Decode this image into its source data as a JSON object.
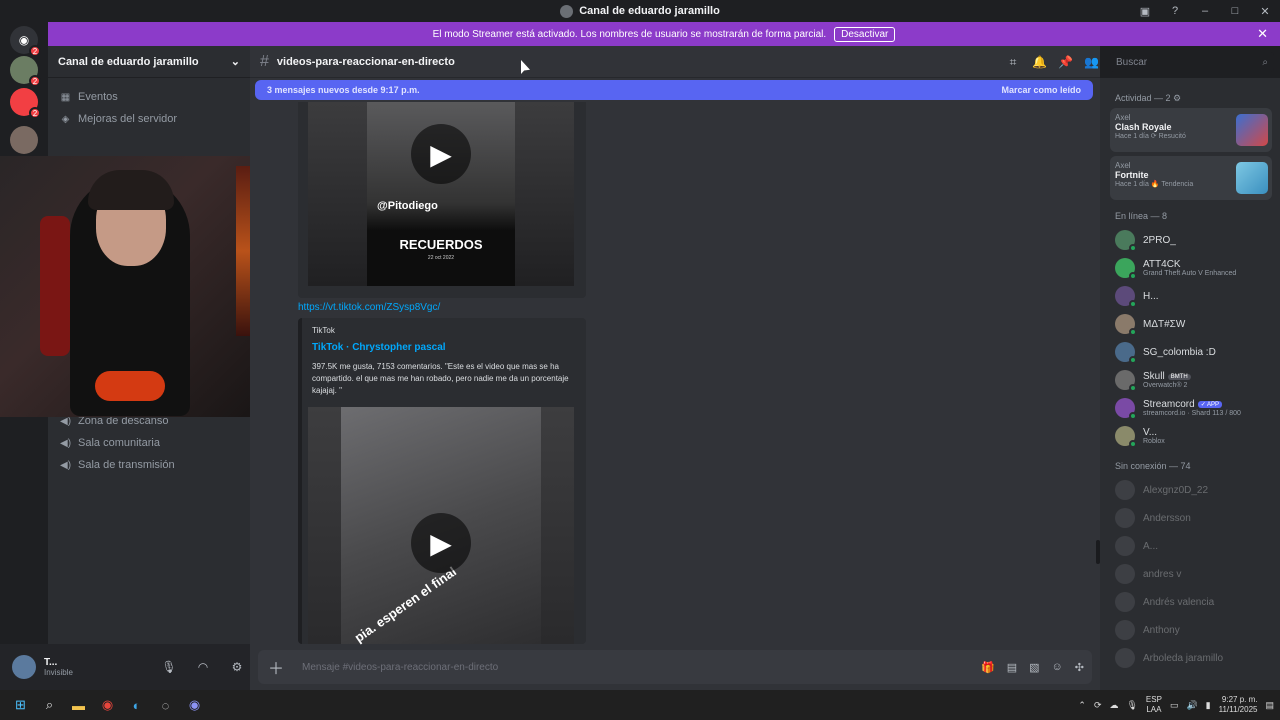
{
  "window": {
    "title": "Canal de eduardo jaramillo"
  },
  "streamer_banner": {
    "text": "El modo Streamer está activado. Los nombres de usuario se mostrarán de forma parcial.",
    "button": "Desactivar"
  },
  "guilds": [
    {
      "badge": "2"
    },
    {
      "badge": "2"
    },
    {
      "badge": "2"
    }
  ],
  "sidebar": {
    "server_name": "Canal de eduardo jaramillo",
    "top_items": [
      "Eventos",
      "Mejoras del servidor"
    ],
    "voice_channels": [
      "Zona de descanso",
      "Sala comunitaria",
      "Sala de transmisión"
    ]
  },
  "user": {
    "name": "T...",
    "status": "Invisible"
  },
  "channel": {
    "name": "videos-para-reaccionar-en-directo"
  },
  "new_messages": {
    "text": "3 mensajes nuevos desde 9:17 p.m.",
    "action": "Marcar como leído"
  },
  "search": {
    "placeholder": "Buscar"
  },
  "embed1": {
    "watermark": "@Pitodiego",
    "caption": "RECUERDOS",
    "date": "22 oct 2022"
  },
  "link": "https://vt.tiktok.com/ZSysp8Vgc/",
  "embed2": {
    "provider": "TikTok",
    "title": "TikTok · Chrystopher pascal",
    "description": "397.5K me gusta, 7153 comentarios. \"Este es el video que mas se ha compartido. el que mas me han robado, pero nadie me da un porcentaje kajajaj. \"",
    "overlay": "pia. esperen el final"
  },
  "composer": {
    "placeholder": "Mensaje #videos-para-reaccionar-en-directo"
  },
  "members": {
    "activity_header": "Actividad — 2",
    "activities": [
      {
        "who": "Axel",
        "game": "Clash Royale",
        "meta": "Hace 1 día  ⟳ Resucitó"
      },
      {
        "who": "Axel",
        "game": "Fortnite",
        "meta": "Hace 1 día  🔥 Tendencia"
      }
    ],
    "online_header": "En línea — 8",
    "online": [
      {
        "name": "2PRO_",
        "status": ""
      },
      {
        "name": "ATT4CK",
        "status": "Grand Theft Auto V Enhanced"
      },
      {
        "name": "H...",
        "status": ""
      },
      {
        "name": "MΔT#ΣW",
        "status": ""
      },
      {
        "name": "SG_colombia :D",
        "status": ""
      },
      {
        "name": "Skull",
        "status": "Overwatch® 2",
        "tag": "BMTH"
      },
      {
        "name": "Streamcord",
        "status": "streamcord.io · Shard 113 / 800",
        "tag": "✓ APP"
      },
      {
        "name": "V...",
        "status": "Roblox"
      }
    ],
    "offline_header": "Sin conexión — 74",
    "offline": [
      "Alexgnz0D_22",
      "Andersson",
      "A...",
      "andres v",
      "Andrés valencia",
      "Anthony",
      "Arboleda jaramillo"
    ]
  },
  "taskbar": {
    "lang": "ESP",
    "lang2": "LAA",
    "time": "9:27 p. m.",
    "date": "11/11/2025"
  }
}
